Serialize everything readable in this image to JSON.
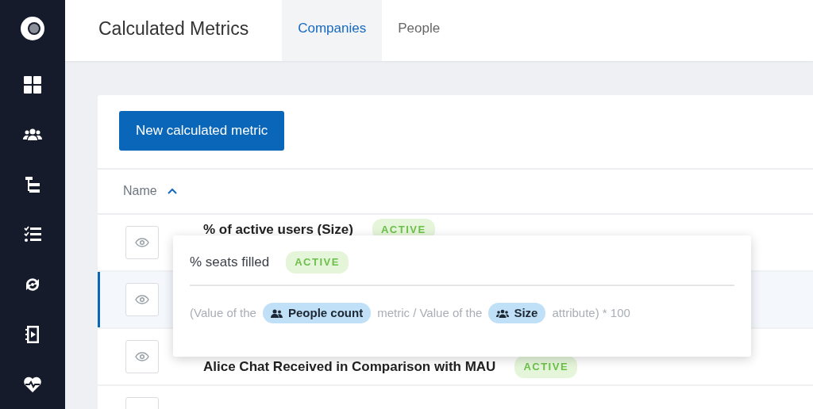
{
  "header": {
    "title": "Calculated Metrics",
    "tabs": [
      {
        "label": "Companies",
        "selected": true
      },
      {
        "label": "People",
        "selected": false
      }
    ]
  },
  "new_button": "New calculated metric",
  "table": {
    "columns": [
      {
        "label": "Name"
      }
    ],
    "rows": [
      {
        "name": "% of active users (Size)",
        "status": "ACTIVE",
        "selected": false
      },
      {
        "selected": true
      },
      {
        "name": "Alice Chat Received in Comparison with MAU",
        "status": "ACTIVE",
        "selected": false
      },
      {
        "selected": false
      }
    ]
  },
  "popover": {
    "title": "% seats filled",
    "status": "ACTIVE",
    "formula": [
      {
        "kind": "text",
        "text": "(Value of the"
      },
      {
        "kind": "chip",
        "text": "People count"
      },
      {
        "kind": "text",
        "text": "metric / Value of the"
      },
      {
        "kind": "chip",
        "text": "Size"
      },
      {
        "kind": "text",
        "text": "attribute) * 100"
      }
    ]
  }
}
